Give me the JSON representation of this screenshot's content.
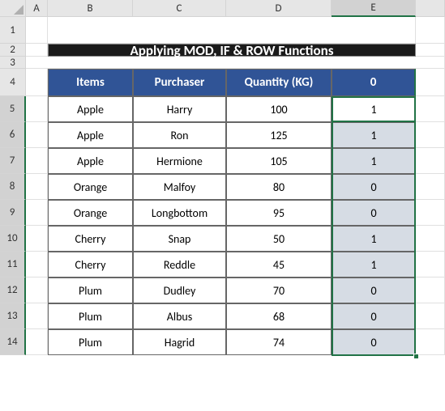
{
  "columns": [
    "A",
    "B",
    "C",
    "D",
    "E"
  ],
  "selected_column": "E",
  "title": "Applying MOD, IF & ROW Functions",
  "headers": {
    "items": "Items",
    "purchaser": "Purchaser",
    "quantity": "Quantity (KG)",
    "flag": "0"
  },
  "rows": [
    {
      "n": "5",
      "items": "Apple",
      "purchaser": "Harry",
      "qty": "100",
      "flag": "1",
      "first": true
    },
    {
      "n": "6",
      "items": "Apple",
      "purchaser": "Ron",
      "qty": "125",
      "flag": "1"
    },
    {
      "n": "7",
      "items": "Apple",
      "purchaser": "Hermione",
      "qty": "105",
      "flag": "1"
    },
    {
      "n": "8",
      "items": "Orange",
      "purchaser": "Malfoy",
      "qty": "80",
      "flag": "0"
    },
    {
      "n": "9",
      "items": "Orange",
      "purchaser": "Longbottom",
      "qty": "95",
      "flag": "0"
    },
    {
      "n": "10",
      "items": "Cherry",
      "purchaser": "Snap",
      "qty": "50",
      "flag": "1"
    },
    {
      "n": "11",
      "items": "Cherry",
      "purchaser": "Reddle",
      "qty": "45",
      "flag": "1"
    },
    {
      "n": "12",
      "items": "Plum",
      "purchaser": "Dudley",
      "qty": "70",
      "flag": "0"
    },
    {
      "n": "13",
      "items": "Plum",
      "purchaser": "Albus",
      "qty": "68",
      "flag": "0"
    },
    {
      "n": "14",
      "items": "Plum",
      "purchaser": "Hagrid",
      "qty": "74",
      "flag": "0"
    }
  ],
  "row_labels_top": [
    "1",
    "2",
    "3",
    "4"
  ],
  "chart_data": {
    "type": "table",
    "title": "Applying MOD, IF & ROW Functions",
    "columns": [
      "Items",
      "Purchaser",
      "Quantity (KG)",
      "0"
    ],
    "data": [
      [
        "Apple",
        "Harry",
        100,
        1
      ],
      [
        "Apple",
        "Ron",
        125,
        1
      ],
      [
        "Apple",
        "Hermione",
        105,
        1
      ],
      [
        "Orange",
        "Malfoy",
        80,
        0
      ],
      [
        "Orange",
        "Longbottom",
        95,
        0
      ],
      [
        "Cherry",
        "Snap",
        50,
        1
      ],
      [
        "Cherry",
        "Reddle",
        45,
        1
      ],
      [
        "Plum",
        "Dudley",
        70,
        0
      ],
      [
        "Plum",
        "Albus",
        68,
        0
      ],
      [
        "Plum",
        "Hagrid",
        74,
        0
      ]
    ]
  }
}
